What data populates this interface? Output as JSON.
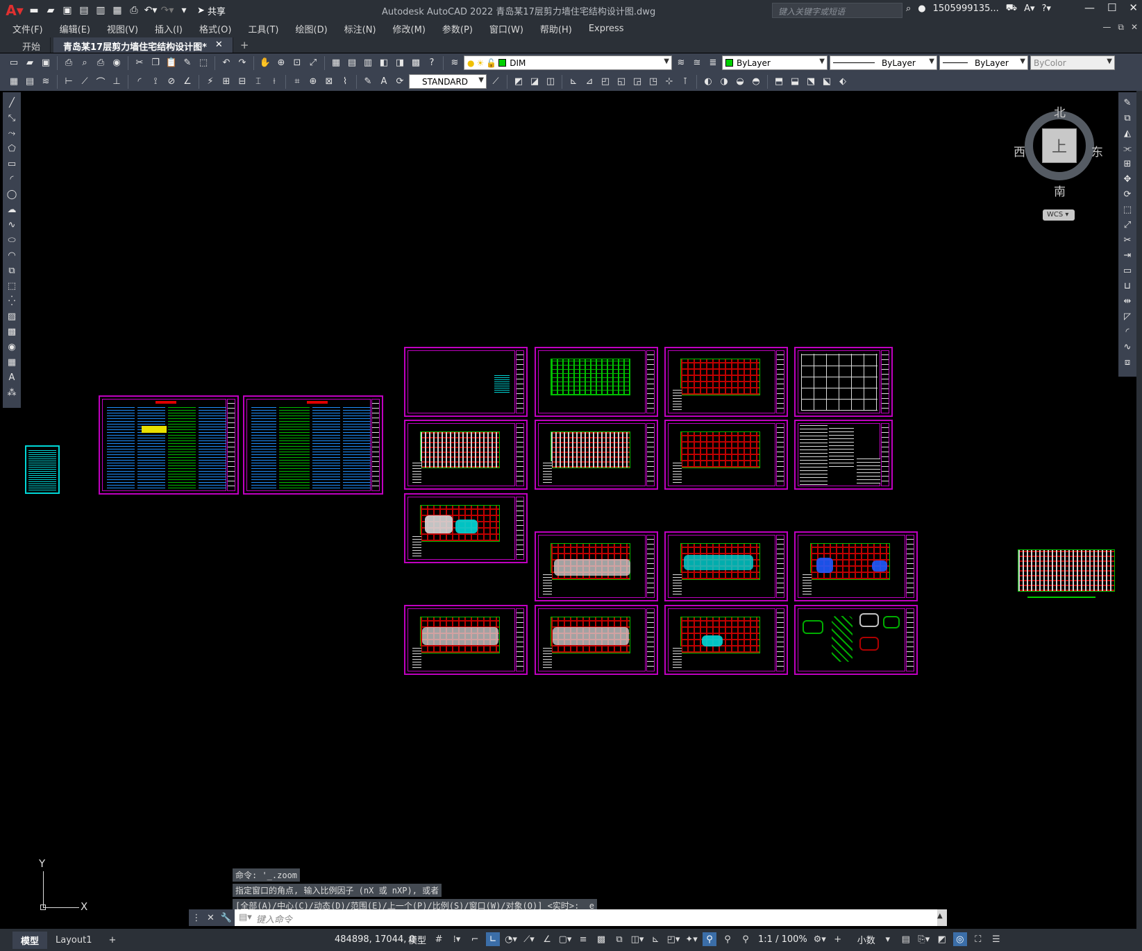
{
  "window": {
    "title": "Autodesk AutoCAD 2022    青岛某17层剪力墙住宅结构设计图.dwg",
    "search_placeholder": "键入关键字或短语",
    "user": "1505999135...",
    "share_label": "共享"
  },
  "menu": [
    "文件(F)",
    "编辑(E)",
    "视图(V)",
    "插入(I)",
    "格式(O)",
    "工具(T)",
    "绘图(D)",
    "标注(N)",
    "修改(M)",
    "参数(P)",
    "窗口(W)",
    "帮助(H)",
    "Express"
  ],
  "tabs": {
    "start": "开始",
    "active": "青岛某17层剪力墙住宅结构设计图*",
    "close": "✕",
    "add": "+"
  },
  "toolbar": {
    "layer": "DIM",
    "color": "ByLayer",
    "linetype": "ByLayer",
    "lineweight": "ByLayer",
    "plotstyle": "ByColor",
    "textstyle": "STANDARD"
  },
  "viewcube": {
    "north": "北",
    "south": "南",
    "east": "东",
    "west": "西",
    "face": "上",
    "wcs": "WCS"
  },
  "ucs": {
    "x": "X",
    "y": "Y"
  },
  "command": {
    "history": [
      "命令: '_.zoom",
      "指定窗口的角点, 输入比例因子 (nX 或 nXP), 或者",
      "[全部(A)/中心(C)/动态(D)/范围(E)/上一个(P)/比例(S)/窗口(W)/对象(O)] <实时>: _e"
    ],
    "placeholder": "键入命令"
  },
  "status": {
    "model_tab": "模型",
    "layout_tab": "Layout1",
    "add": "+",
    "coords": "484898, 17044, 0",
    "space": "模型",
    "scale": "1:1 / 100%",
    "units": "小数"
  },
  "colors": {
    "sheet_border": "#c000c0",
    "grid_red": "#c00000",
    "dim_green": "#00d000",
    "note_cyan": "#00d8d8"
  }
}
